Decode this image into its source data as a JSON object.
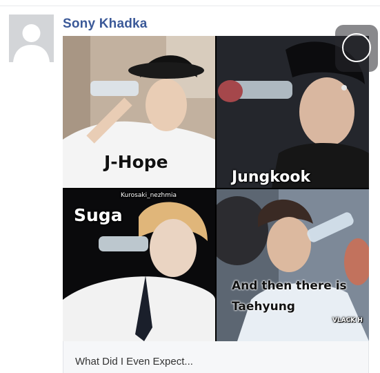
{
  "post": {
    "author": "Sony Khadka",
    "caption": "What Did I Even Expect..."
  },
  "collage": {
    "panel_1": {
      "caption": "J-Hope"
    },
    "panel_2": {
      "caption": "Jungkook"
    },
    "panel_3": {
      "caption": "Suga",
      "watermark": "Kurosaki_nezhmia"
    },
    "panel_4": {
      "caption_line1": "And then there is",
      "caption_line2": "Taehyung",
      "watermark": "VLACK H"
    }
  },
  "icons": {
    "avatar": "default-avatar-icon",
    "overlay": "circle-button-icon"
  },
  "colors": {
    "author_name": "#3b5998",
    "avatar_bg": "#d3d5d8",
    "caption_bg": "#f6f7f9"
  }
}
